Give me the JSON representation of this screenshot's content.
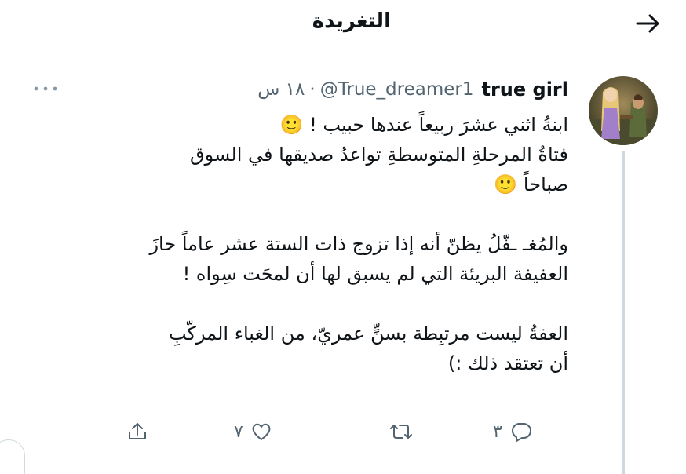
{
  "header": {
    "title": "التغريدة",
    "back_icon": "arrow-right-icon"
  },
  "tweet": {
    "display_name": "true girl",
    "handle": "@True_dreamer1",
    "separator": "·",
    "time": "١٨ س",
    "more_icon": "more-dots-icon",
    "lines": [
      "ابنةُ اثني عشرَ ربيعاً عندها حبيب ! 🙂",
      "فتاةُ المرحلةِ المتوسطةِ تواعدُ صديقها في السوق",
      "صباحاً 🙂",
      "",
      "والمُغـ ـفّلُ يظنّ أنه إذا تزوج ذات الستة عشر عاماً حازَ",
      "العفيفة البريئة التي لم يسبق لها أن لمحَت سِواه !",
      "",
      "العفةُ ليست مرتبِطة بسنٍّ عمريّ، من الغباء المركّبِ",
      "أن تعتقد ذلك :)"
    ],
    "actions": {
      "reply_count": "٣",
      "retweet_count": "",
      "like_count": "٧",
      "reply_icon": "reply-icon",
      "retweet_icon": "retweet-icon",
      "like_icon": "heart-icon",
      "share_icon": "share-icon"
    }
  },
  "colors": {
    "text": "#0f1419",
    "secondary": "#536471",
    "divider": "#cfd9de",
    "emoji": "#f7c531"
  }
}
